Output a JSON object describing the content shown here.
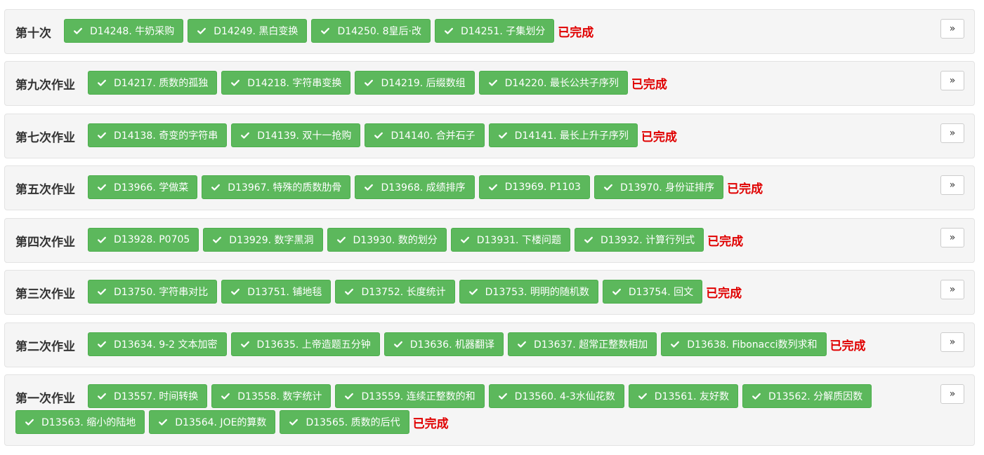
{
  "done_label": "已完成",
  "colors": {
    "chip_bg": "#5cb85c",
    "done_text": "#e00000",
    "row_bg": "#f5f5f5"
  },
  "icons": {
    "chip_icon": "check-icon",
    "expand_icon": "double-chevron-right-icon",
    "expand_glyph": "»"
  },
  "homework": [
    {
      "title": "第十次",
      "problems": [
        "D14248. 牛奶采购",
        "D14249. 黑白变换",
        "D14250. 8皇后·改",
        "D14251. 子集划分"
      ]
    },
    {
      "title": "第九次作业",
      "problems": [
        "D14217. 质数的孤独",
        "D14218. 字符串变换",
        "D14219. 后缀数组",
        "D14220. 最长公共子序列"
      ]
    },
    {
      "title": "第七次作业",
      "problems": [
        "D14138. 奇变的字符串",
        "D14139. 双十一抢购",
        "D14140. 合并石子",
        "D14141. 最长上升子序列"
      ]
    },
    {
      "title": "第五次作业",
      "problems": [
        "D13966. 学做菜",
        "D13967. 特殊的质数肋骨",
        "D13968. 成绩排序",
        "D13969. P1103",
        "D13970. 身份证排序"
      ]
    },
    {
      "title": "第四次作业",
      "problems": [
        "D13928. P0705",
        "D13929. 数字黑洞",
        "D13930. 数的划分",
        "D13931. 下楼问题",
        "D13932. 计算行列式"
      ]
    },
    {
      "title": "第三次作业",
      "problems": [
        "D13750. 字符串对比",
        "D13751. 铺地毯",
        "D13752. 长度统计",
        "D13753. 明明的随机数",
        "D13754. 回文"
      ]
    },
    {
      "title": "第二次作业",
      "problems": [
        "D13634. 9-2 文本加密",
        "D13635. 上帝造题五分钟",
        "D13636. 机器翻译",
        "D13637. 超常正整数相加",
        "D13638. Fibonacci数列求和"
      ]
    },
    {
      "title": "第一次作业",
      "problems": [
        "D13557. 时间转换",
        "D13558. 数字统计",
        "D13559. 连续正整数的和",
        "D13560. 4-3水仙花数",
        "D13561. 友好数",
        "D13562. 分解质因数",
        "D13563. 缩小的陆地",
        "D13564. JOE的算数",
        "D13565. 质数的后代"
      ]
    }
  ]
}
